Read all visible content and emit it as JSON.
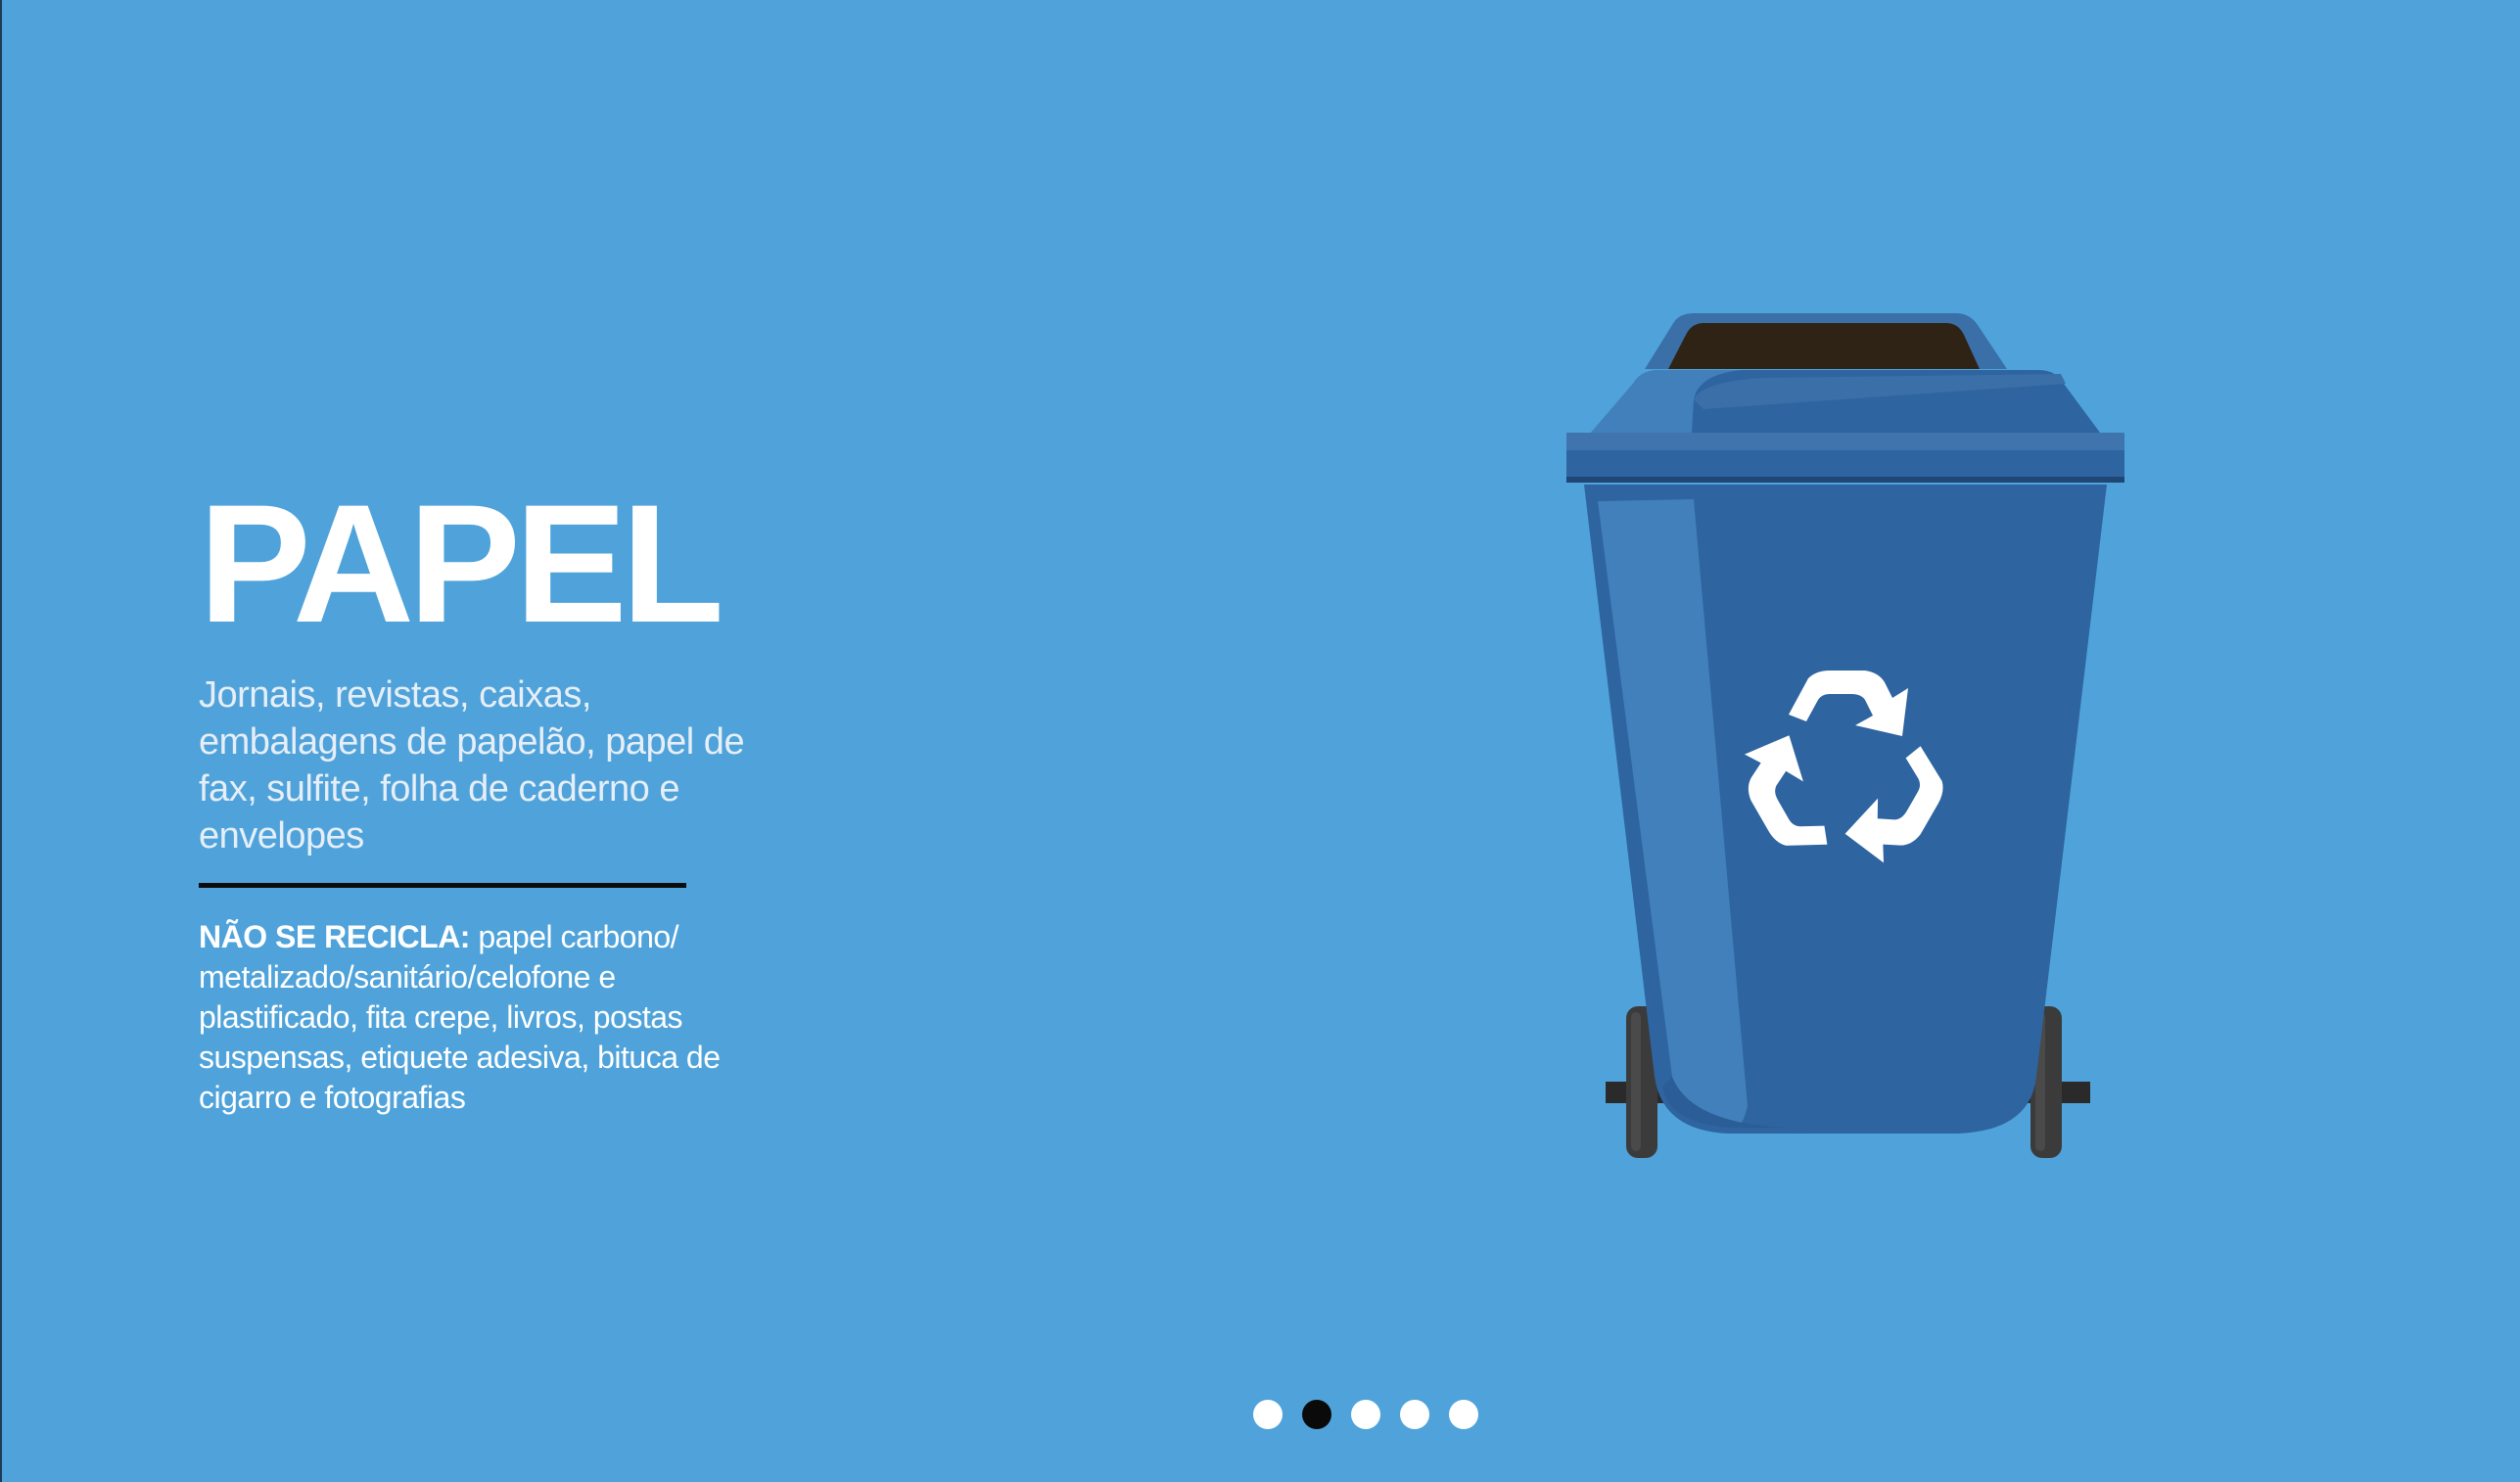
{
  "slide": {
    "title": "PAPEL",
    "description": "Jornais, revistas, caixas, embalagens de papelão, papel de fax, sulfite, folha de caderno e envelopes",
    "not_recycled_lead": "NÃO SE RECICLA:",
    "not_recycled_text": " papel carbono/ metalizado/sanitário/celofone e plastificado, fita crepe, livros, postas suspensas, etiquete adesiva, bituca de cigarro e fotografias",
    "illustration": "recycling-bin-icon",
    "recycle_symbol": "recycle-icon"
  },
  "colors": {
    "background": "#4fa3da",
    "bin_body": "#2e64a0",
    "bin_highlight": "#4180bb",
    "bin_lid_rim": "#3a6fa8",
    "bin_opening": "#2f2315",
    "wheels": "#3b3b3b",
    "divider": "#0c0c0c",
    "dot_active": "#0a0a0a",
    "dot_inactive": "#ffffff"
  },
  "pagination": {
    "total": 5,
    "active_index": 1
  }
}
